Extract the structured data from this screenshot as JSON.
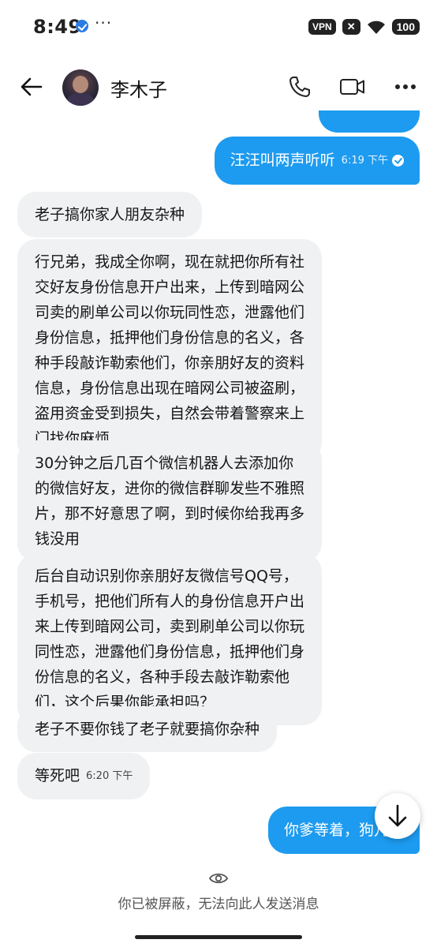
{
  "status_bar": {
    "time": "8:49",
    "dots": "···",
    "vpn": "VPN",
    "x_badge": "✕",
    "battery": "100"
  },
  "header": {
    "contact_name": "李木子"
  },
  "colors": {
    "outgoing_bubble": "#1d9bf0",
    "incoming_bubble": "#eff1f3"
  },
  "messages": [
    {
      "direction": "out",
      "text": "汪汪叫两声听听",
      "time": "6:19 下午"
    },
    {
      "direction": "in",
      "text": "老子搞你家人朋友杂种"
    },
    {
      "direction": "in",
      "lines": [
        "行兄弟，我成全你啊，现在就把你所有社",
        "交好友身份信息开户出来，上传到暗网公",
        "司卖的刷单公司以你玩同性恋，泄露他们",
        "身份信息，抵押他们身份信息的名义，各",
        "种手段敲诈勒索他们，你亲朋好友的资料",
        "信息，身份信息出现在暗网公司被盗刷，",
        "盗用资金受到损失，自然会带着警察来上",
        "门找你麻烦"
      ]
    },
    {
      "direction": "in",
      "lines": [
        "30分钟之后几百个微信机器人去添加你",
        "的微信好友，进你的微信群聊发些不雅照",
        "片，那不好意思了啊，到时候你给我再多",
        "钱没用"
      ]
    },
    {
      "direction": "in",
      "lines": [
        "后台自动识别你亲朋好友微信号QQ号，",
        "手机号，把他们所有人的身份信息开户出",
        "来上传到暗网公司，卖到刷单公司以你玩",
        "同性恋，泄露他们身份信息，抵押他们身",
        "份信息的名义，各种手段去敲诈勒索他",
        "们，这个后果你能承担吗？"
      ]
    },
    {
      "direction": "in",
      "text": "老子不要你钱了老子就要搞你杂种"
    },
    {
      "direction": "in",
      "text": "等死吧",
      "time": "6:20 下午"
    },
    {
      "direction": "out",
      "text": "你爹等着，狗儿子"
    }
  ],
  "footer": {
    "blocked_notice": "你已被屏蔽，无法向此人发送消息"
  }
}
